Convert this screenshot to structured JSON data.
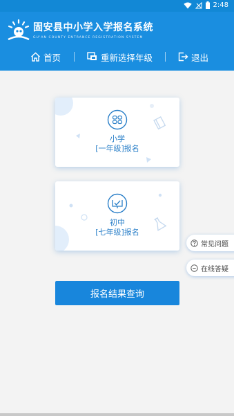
{
  "status_bar": {
    "time": "2:48"
  },
  "header": {
    "title": "固安县中小学入学报名系统",
    "subtitle": "GU'AN COUNTY ENTRANCE REGISTRATION SYSTEM"
  },
  "nav": {
    "home": "首页",
    "reselect": "重新选择年级",
    "logout": "退出"
  },
  "cards": {
    "primary": {
      "line1": "小学",
      "line2": "[一年级]报名"
    },
    "junior": {
      "line1": "初中",
      "line2": "[七年级]报名"
    }
  },
  "query_button": "报名结果查询",
  "floating": {
    "faq": "常见问题",
    "online": "在线答疑"
  },
  "colors": {
    "brand": "#1a8ee0",
    "accent_text": "#2a7fc8"
  }
}
